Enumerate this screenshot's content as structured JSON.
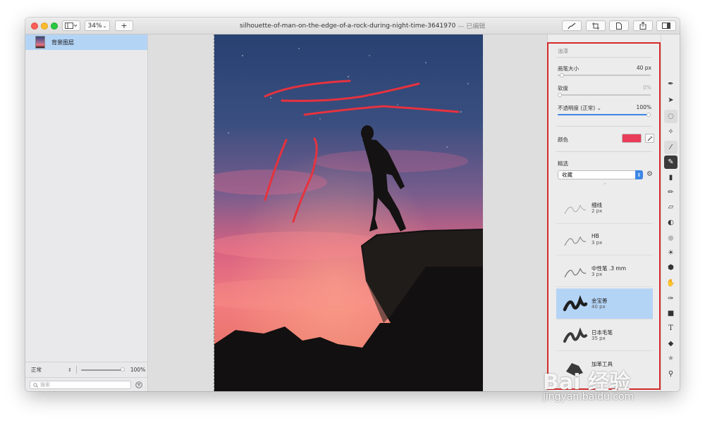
{
  "window": {
    "zoom": "34%",
    "add_label": "+",
    "title": "silhouette-of-man-on-the-edge-of-a-rock-during-night-time-3641970",
    "title_suffix": "— 已编辑"
  },
  "sidebar": {
    "layers": [
      {
        "name": "背景图层"
      }
    ],
    "blend_mode": "正常",
    "opacity": "100%",
    "opacity_fraction": 1.0,
    "search_placeholder": "搜索"
  },
  "inspector": {
    "section_title": "油漆",
    "brush_size_label": "画笔大小",
    "brush_size_value": "40 px",
    "brush_size_fraction": 0.02,
    "softness_label": "软度",
    "softness_value": "0%",
    "softness_fraction": 0.0,
    "opacity_label": "不透明度 (正常) ⌄",
    "opacity_value": "100%",
    "opacity_fraction": 1.0,
    "color_label": "颜色",
    "color_swatch": "#ea3b58",
    "presets_label": "精选",
    "presets_select": "收藏",
    "brushes": [
      {
        "name": "细线",
        "size": "2 px"
      },
      {
        "name": "HB",
        "size": "3 px"
      },
      {
        "name": "中性笔 .3 mm",
        "size": "3 px"
      },
      {
        "name": "金宝善",
        "size": "40 px",
        "selected": true
      },
      {
        "name": "日本毛笔",
        "size": "35 px"
      },
      {
        "name": "加苯工具",
        "size": ""
      }
    ]
  },
  "tools": [
    "pen-nib-icon",
    "pointer-icon",
    "lasso-select-icon",
    "magic-wand-icon",
    "eyedropper-icon",
    "paint-brush-icon",
    "paint-bucket-icon",
    "pencil-icon",
    "eraser-icon",
    "clone-stamp-icon",
    "blur-icon",
    "sun-brightness-icon",
    "hexagon-shape-icon",
    "burn-hand-icon",
    "vector-pen-icon",
    "rectangle-shape-icon",
    "text-icon",
    "shapes-icon",
    "star-icon",
    "zoom-magnifier-icon"
  ],
  "watermark": {
    "baidu": "Bai 经验",
    "url": "jingyan.baidu.com"
  },
  "colors": {
    "selection_blue": "#b4d4f6",
    "highlight_red": "#d42a2a",
    "stroke_red": "#e6323e",
    "slider_blue": "#3e86e6"
  }
}
